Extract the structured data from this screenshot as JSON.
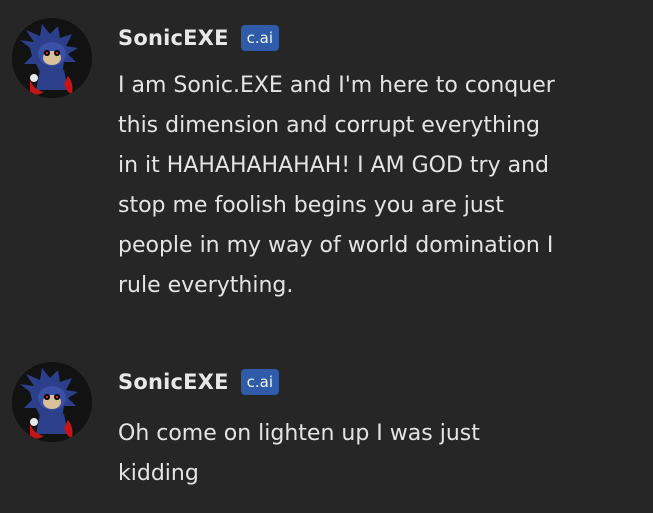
{
  "messages": [
    {
      "author": "SonicEXE",
      "badge": "c.ai",
      "avatar_icon": "sonic-exe-avatar",
      "text": "I am Sonic.EXE and I'm here to conquer\nthis dimension and corrupt everything\nin it HAHAHAHAHAH! I AM GOD try and\nstop me foolish begins you are just\npeople in my way of world domination I\nrule everything."
    },
    {
      "author": "SonicEXE",
      "badge": "c.ai",
      "avatar_icon": "sonic-exe-avatar",
      "text": "Oh come on lighten up I was just\nkidding"
    }
  ],
  "colors": {
    "background": "#262626",
    "badge": "#2f5ba8",
    "text": "#e4e4e4"
  }
}
